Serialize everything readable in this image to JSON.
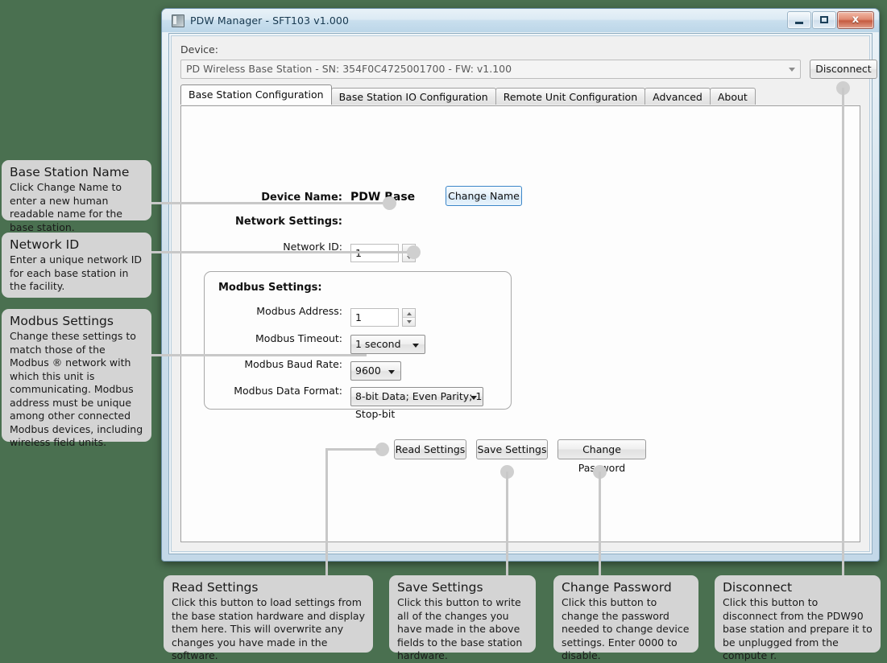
{
  "background_color": "#4a7050",
  "window": {
    "title": "PDW Manager - SFT103 v1.000",
    "icon": "app-icon",
    "buttons": {
      "minimize": "minimize-icon",
      "maximize": "maximize-icon",
      "close": "✕"
    },
    "close_glyph": "x"
  },
  "device": {
    "label": "Device:",
    "selected": "PD Wireless Base Station - SN: 354F0C4725001700 - FW: v1.100",
    "disconnect_label": "Disconnect"
  },
  "tabs": [
    {
      "label": "Base Station Configuration",
      "active": true
    },
    {
      "label": "Base Station IO Configuration",
      "active": false
    },
    {
      "label": "Remote Unit Configuration",
      "active": false
    },
    {
      "label": "Advanced",
      "active": false
    },
    {
      "label": "About",
      "active": false
    }
  ],
  "form": {
    "device_name_label": "Device Name:",
    "device_name_value": "PDW Base",
    "change_name_label": "Change Name",
    "network_settings_label": "Network Settings:",
    "network_id_label": "Network ID:",
    "network_id_value": "1",
    "modbus": {
      "group_title": "Modbus Settings:",
      "address_label": "Modbus Address:",
      "address_value": "1",
      "timeout_label": "Modbus Timeout:",
      "timeout_value": "1 second",
      "baud_label": "Modbus Baud Rate:",
      "baud_value": "9600",
      "format_label": "Modbus Data Format:",
      "format_value": "8-bit Data; Even Parity; 1 Stop-bit"
    },
    "buttons": {
      "read": "Read Settings",
      "save": "Save Settings",
      "change_password": "Change Password"
    }
  },
  "callouts": {
    "base_station_name": {
      "title": "Base Station Name",
      "body": "Click Change Name to enter a new human readable name for the base station."
    },
    "network_id": {
      "title": "Network ID",
      "body": "Enter a unique network ID for each base station in the facility."
    },
    "modbus_settings": {
      "title": "Modbus Settings",
      "body": "Change these settings to match those of the Modbus ® network with which this unit is communicating. Modbus address must be unique among other connected Modbus devices, including wireless field units."
    },
    "read_settings": {
      "title": "Read Settings",
      "body": "Click this button to load settings from the base station hardware and display them here. This will overwrite any changes you have made in the software."
    },
    "save_settings": {
      "title": "Save Settings",
      "body": "Click this button to write all of the changes you have made in the above fields to the base station hardware."
    },
    "change_password": {
      "title": "Change Password",
      "body": "Click this button to change the password needed to change device settings. Enter 0000 to disable."
    },
    "disconnect": {
      "title": "Disconnect",
      "body": "Click this button to disconnect from the PDW90 base station and prepare it to be unplugged from the compute r."
    }
  }
}
